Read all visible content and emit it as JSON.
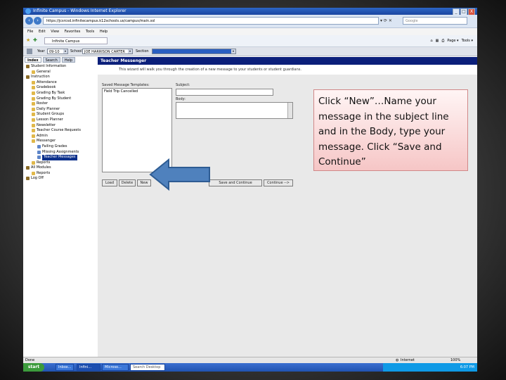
{
  "window": {
    "title": "Infinite Campus - Windows Internet Explorer",
    "address": "https://jcsrcsd.infinitecampus.k12schools.us/campus/main.xsl",
    "search_placeholder": "Google",
    "fav_tab": "Infinite Campus",
    "minimize": "_",
    "maximize": "□",
    "close": "X"
  },
  "menu": [
    "File",
    "Edit",
    "View",
    "Favorites",
    "Tools",
    "Help"
  ],
  "cmdbar": {
    "page": "Page ▾",
    "tools": "Tools ▾"
  },
  "app": {
    "year_label": "Year",
    "year_value": "09-10",
    "school_label": "School",
    "school_value": "JOE HARRISON CARTER",
    "section_label": "Section",
    "section_value": "",
    "tabs": [
      "Index",
      "Search",
      "Help"
    ],
    "tree": [
      {
        "label": "Student Information",
        "indent": 0
      },
      {
        "label": "General",
        "indent": 1
      },
      {
        "label": "Instruction",
        "indent": 0
      },
      {
        "label": "Attendance",
        "indent": 1
      },
      {
        "label": "Gradebook",
        "indent": 1
      },
      {
        "label": "Grading By Task",
        "indent": 1
      },
      {
        "label": "Grading By Student",
        "indent": 1
      },
      {
        "label": "Roster",
        "indent": 1
      },
      {
        "label": "Daily Planner",
        "indent": 1
      },
      {
        "label": "Student Groups",
        "indent": 1
      },
      {
        "label": "Lesson Planner",
        "indent": 1
      },
      {
        "label": "Newsletter",
        "indent": 1
      },
      {
        "label": "Teacher Course Requests",
        "indent": 1
      },
      {
        "label": "Admin",
        "indent": 1
      },
      {
        "label": "Messenger",
        "indent": 1
      },
      {
        "label": "Failing Grades",
        "indent": 2
      },
      {
        "label": "Missing Assignments",
        "indent": 2
      },
      {
        "label": "Teacher Messages",
        "indent": 2,
        "selected": true
      },
      {
        "label": "Reports",
        "indent": 1
      },
      {
        "label": "All Modules",
        "indent": 0
      },
      {
        "label": "Reports",
        "indent": 1
      },
      {
        "label": "Log Off",
        "indent": 0
      }
    ],
    "pane_title": "Teacher Messenger",
    "pane_intro": "This wizard will walk you through the creation of a new message to your students or student guardians.",
    "templates_label": "Saved Message Templates:",
    "template_item": "Field Trip Cancelled",
    "subject_label": "Subject:",
    "body_label": "Body:",
    "buttons": {
      "load": "Load",
      "delete": "Delete",
      "new": "New",
      "save_continue": "Save and Continue",
      "continue": "Continue -->"
    }
  },
  "callout": {
    "text": "Click “New”…Name your message in the subject line and in the Body, type your message.  Click “Save and Continue”"
  },
  "status": {
    "left": "Done",
    "zone": "Internet",
    "zoom": "100%"
  },
  "taskbar": {
    "start": "start",
    "items": [
      "Inbox...",
      "Infini...",
      "Microso...",
      "Search Desktop"
    ],
    "clock": "6:07 PM"
  },
  "colors": {
    "arrow_fill": "#4f81bd",
    "arrow_stroke": "#2e5c93",
    "callout_bg": "#f6c6c6",
    "pane_header": "#0b1f7a"
  }
}
